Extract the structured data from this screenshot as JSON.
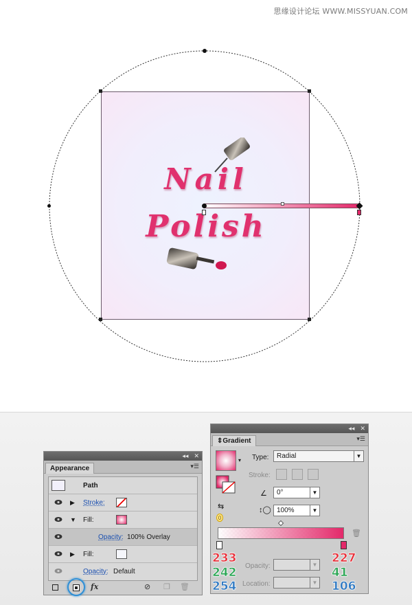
{
  "watermark": "思缘设计论坛 WWW.MISSYUAN.COM",
  "artwork": {
    "line1": "Nail",
    "line2": "Polish"
  },
  "appearance_panel": {
    "tab": "Appearance",
    "rows": [
      {
        "label": "Path"
      },
      {
        "label": "Stroke:"
      },
      {
        "label": "Fill:"
      },
      {
        "label": "Opacity:",
        "value": "100% Overlay"
      },
      {
        "label": "Fill:"
      },
      {
        "label": "Opacity:",
        "value": "Default"
      }
    ],
    "footer_icons": [
      "new-stroke-icon",
      "new-fill-icon",
      "fx-icon",
      "clear-appearance-icon",
      "duplicate-icon",
      "trash-icon"
    ],
    "fx_label": "fx"
  },
  "gradient_panel": {
    "tab": "Gradient",
    "type_label": "Type:",
    "type_value": "Radial",
    "stroke_label": "Stroke:",
    "angle_value": "0°",
    "aspect_value": "100%",
    "opacity_label": "Opacity:",
    "location_label": "Location:",
    "small_badge": "0",
    "left_stop": {
      "r": "233",
      "g": "242",
      "b": "254"
    },
    "right_stop": {
      "r": "227",
      "g": "41",
      "b": "106"
    },
    "colors": {
      "start": "#e9f2fe",
      "end": "#e3296a"
    }
  }
}
